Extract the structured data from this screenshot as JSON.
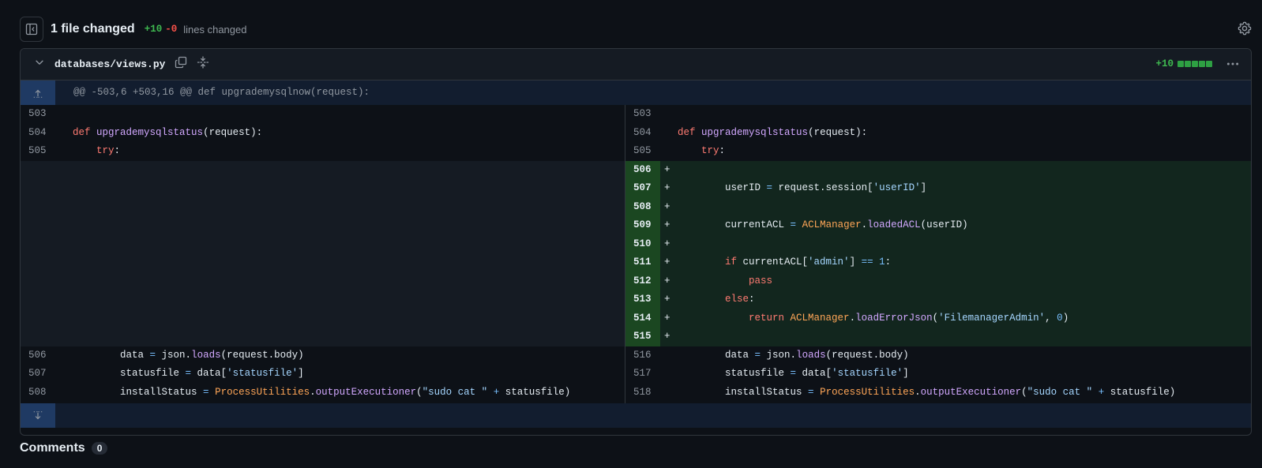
{
  "header": {
    "title": "1 file changed",
    "additions": "+10",
    "deletions": "-0",
    "lines_changed_label": "lines changed"
  },
  "file": {
    "path": "databases/views.py",
    "additions": "+10",
    "stat_bar": [
      true,
      true,
      true,
      true,
      true
    ],
    "hunk_header": "@@ -503,6 +503,16 @@ def upgrademysqlnow(request):"
  },
  "diff": {
    "left_lines": [
      {
        "num": "503",
        "code": ""
      },
      {
        "num": "504",
        "code": "def upgrademysqlstatus(request):"
      },
      {
        "num": "505",
        "code": "    try:"
      },
      {
        "num": "506",
        "code": "        data = json.loads(request.body)"
      },
      {
        "num": "507",
        "code": "        statusfile = data['statusfile']"
      },
      {
        "num": "508",
        "code": "        installStatus = ProcessUtilities.outputExecutioner(\"sudo cat \" + statusfile)"
      }
    ],
    "right_lines": [
      {
        "num": "503",
        "code": "",
        "added": false
      },
      {
        "num": "504",
        "code": "def upgrademysqlstatus(request):",
        "added": false
      },
      {
        "num": "505",
        "code": "    try:",
        "added": false
      },
      {
        "num": "506",
        "code": "",
        "added": true
      },
      {
        "num": "507",
        "code": "        userID = request.session['userID']",
        "added": true
      },
      {
        "num": "508",
        "code": "",
        "added": true
      },
      {
        "num": "509",
        "code": "        currentACL = ACLManager.loadedACL(userID)",
        "added": true
      },
      {
        "num": "510",
        "code": "",
        "added": true
      },
      {
        "num": "511",
        "code": "        if currentACL['admin'] == 1:",
        "added": true
      },
      {
        "num": "512",
        "code": "            pass",
        "added": true
      },
      {
        "num": "513",
        "code": "        else:",
        "added": true
      },
      {
        "num": "514",
        "code": "            return ACLManager.loadErrorJson('FilemanagerAdmin', 0)",
        "added": true
      },
      {
        "num": "515",
        "code": "",
        "added": true
      },
      {
        "num": "516",
        "code": "        data = json.loads(request.body)",
        "added": false
      },
      {
        "num": "517",
        "code": "        statusfile = data['statusfile']",
        "added": false
      },
      {
        "num": "518",
        "code": "        installStatus = ProcessUtilities.outputExecutioner(\"sudo cat \" + statusfile)",
        "added": false
      }
    ],
    "add_marker": "+"
  },
  "comments": {
    "title": "Comments",
    "count": "0"
  },
  "icons": {
    "sidebar_toggle": "sidebar-collapse-icon",
    "settings": "gear-icon",
    "collapse": "chevron-down-icon",
    "copy": "copy-icon",
    "expand_all": "fold-unfold-icon",
    "more": "kebab-horizontal-icon",
    "expand_up": "expand-up-icon",
    "expand_down": "expand-down-icon"
  },
  "colors": {
    "addition": "#3fb950",
    "deletion": "#f85149",
    "keyword": "#ff7b72",
    "function": "#d2a8ff",
    "string": "#a5d6ff",
    "class": "#ffa657",
    "added_background": "#12261e"
  }
}
